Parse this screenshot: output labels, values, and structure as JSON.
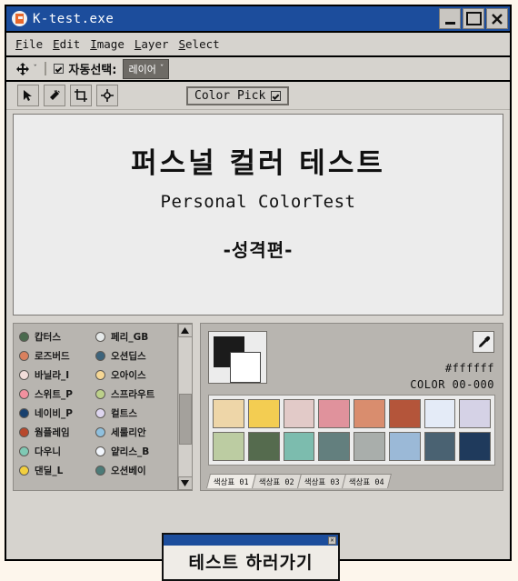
{
  "window": {
    "title": "K-test.exe",
    "icon": "app-icon",
    "controls": [
      {
        "name": "minimize-button",
        "glyph": "_"
      },
      {
        "name": "maximize-button",
        "glyph": "□"
      },
      {
        "name": "close-button",
        "glyph": "✕"
      }
    ]
  },
  "menubar": {
    "items": [
      "File",
      "Edit",
      "Image",
      "Layer",
      "Select"
    ]
  },
  "optionsbar": {
    "tool_icon": "move-tool-icon",
    "tool_caret": "ˇ",
    "checkbox_checked": true,
    "label": "자동선택:",
    "select_value": "레이어",
    "select_caret": "ˇ"
  },
  "toolbar": {
    "tools": [
      {
        "name": "pointer-tool",
        "icon": "cursor-arrow-icon"
      },
      {
        "name": "magic-wand-tool",
        "icon": "magic-wand-icon"
      },
      {
        "name": "crop-tool",
        "icon": "crop-icon"
      },
      {
        "name": "target-move-tool",
        "icon": "target-icon"
      }
    ],
    "colorpick_label": "Color Pick",
    "colorpick_checked": true
  },
  "canvas": {
    "title": "퍼스널 컬러 테스트",
    "subtitle": "Personal ColorTest",
    "section": "-성격편-"
  },
  "swatch_list": {
    "left": [
      {
        "label": "캅터스",
        "color": "#4a6a4e"
      },
      {
        "label": "로즈버드",
        "color": "#d9805e"
      },
      {
        "label": "바닐라_I",
        "color": "#f2ddd9"
      },
      {
        "label": "스위트_P",
        "color": "#f2919f"
      },
      {
        "label": "네이비_P",
        "color": "#18406e"
      },
      {
        "label": "웜플레임",
        "color": "#b8482c"
      },
      {
        "label": "다우니",
        "color": "#7fc9b4"
      },
      {
        "label": "댄딜_L",
        "color": "#f2cf3e"
      }
    ],
    "right": [
      {
        "label": "페리_GB",
        "color": "#e6eaea"
      },
      {
        "label": "오션딥스",
        "color": "#3d647c"
      },
      {
        "label": "오아이스",
        "color": "#f6d795"
      },
      {
        "label": "스프라우트",
        "color": "#bcd08a"
      },
      {
        "label": "컬트스",
        "color": "#ded6ef"
      },
      {
        "label": "세룰리안",
        "color": "#8fc0de"
      },
      {
        "label": "얕리스_B",
        "color": "#f2f6fc"
      },
      {
        "label": "오션베이",
        "color": "#4c7b78"
      }
    ],
    "scrollbar": {
      "up": "▲",
      "down": "▼"
    }
  },
  "color_panel": {
    "foreground": "#1b1b1b",
    "background": "#ffffff",
    "eyedropper_icon": "eyedropper-icon",
    "hex": "#ffffff",
    "color_id": "COLOR 00-000",
    "palette": [
      [
        "#eed6a8",
        "#f3cd52",
        "#e2cac8",
        "#e0929c",
        "#d98d6e",
        "#b4553a",
        "#e4ebf7",
        "#d5d2e6"
      ],
      [
        "#bccca2",
        "#556b4e",
        "#7cbcae",
        "#637f7e",
        "#a9aeab",
        "#9bb9d7",
        "#4a6272",
        "#1f3a5c"
      ]
    ],
    "tabs": [
      {
        "label": "색상표 01",
        "active": true
      },
      {
        "label": "색상표 02",
        "active": false
      },
      {
        "label": "색상표 03",
        "active": false
      },
      {
        "label": "색상표 04",
        "active": false
      }
    ]
  },
  "dialog": {
    "close_glyph": "✕",
    "button_label": "테스트 하러가기"
  }
}
